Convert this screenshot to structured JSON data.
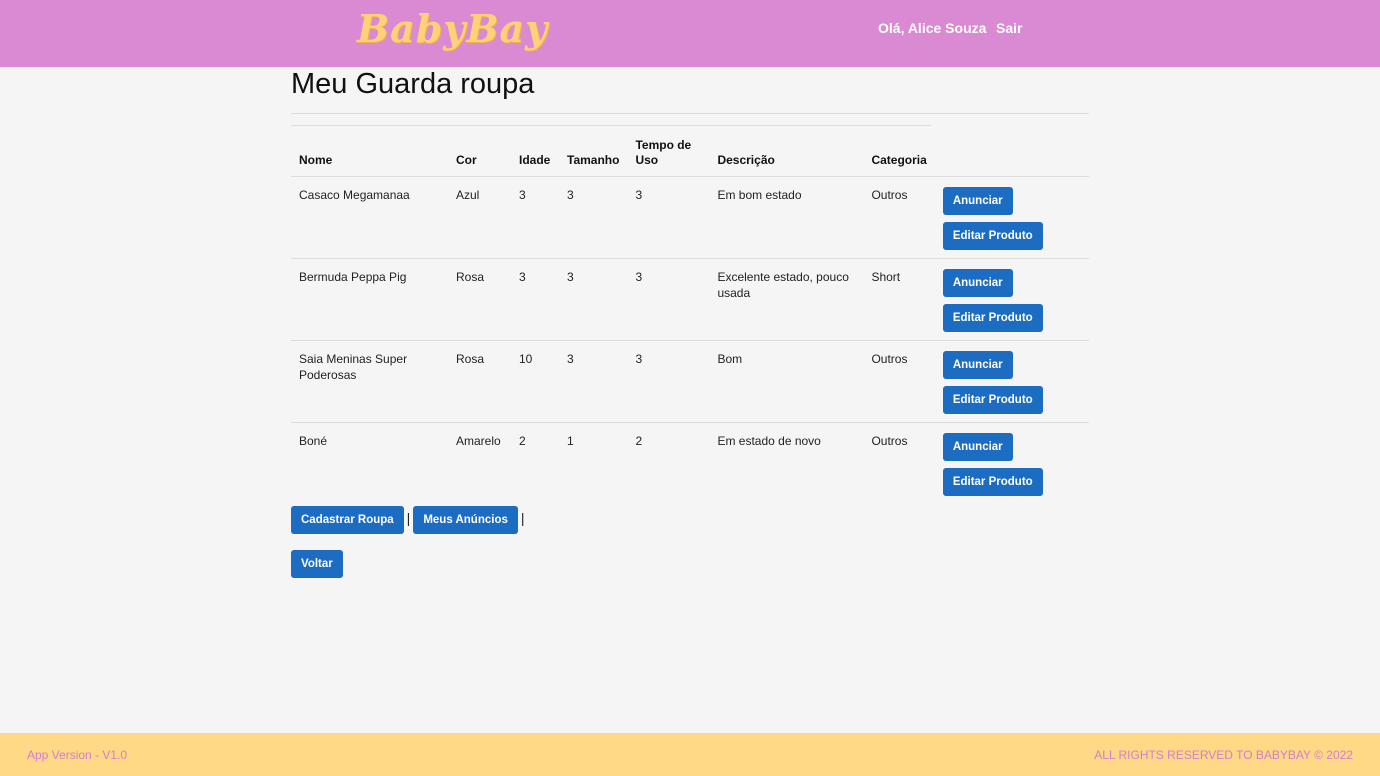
{
  "navbar": {
    "brand": "BabyBay",
    "user_greeting": "Olá, Alice Souza",
    "logout_label": "Sair"
  },
  "page": {
    "title": "Meu Guarda roupa"
  },
  "table": {
    "headers": [
      "Nome",
      "Cor",
      "Idade",
      "Tamanho",
      "Tempo de Uso",
      "Descrição",
      "Categoria"
    ],
    "rows": [
      {
        "nome": "Casaco Megamanaa",
        "cor": "Azul",
        "idade": "3",
        "tamanho": "3",
        "tempo_uso": "3",
        "descricao": "Em bom estado",
        "categoria": "Outros"
      },
      {
        "nome": "Bermuda Peppa Pig",
        "cor": "Rosa",
        "idade": "3",
        "tamanho": "3",
        "tempo_uso": "3",
        "descricao": "Excelente estado, pouco usada",
        "categoria": "Short"
      },
      {
        "nome": "Saia Meninas Super Poderosas",
        "cor": "Rosa",
        "idade": "10",
        "tamanho": "3",
        "tempo_uso": "3",
        "descricao": "Bom",
        "categoria": "Outros"
      },
      {
        "nome": "Boné",
        "cor": "Amarelo",
        "idade": "2",
        "tamanho": "1",
        "tempo_uso": "2",
        "descricao": "Em estado de novo",
        "categoria": "Outros"
      }
    ],
    "announce_label": "Anunciar",
    "edit_label": "Editar Produto"
  },
  "actions": {
    "register_label": "Cadastrar Roupa",
    "separator": "|",
    "my_ads_label": "Meus Anúncios",
    "back_label": "Voltar"
  },
  "footer": {
    "version": "App Version - V1.0",
    "rights": "ALL RIGHTS RESERVED TO BABYBAY © 2022"
  },
  "colors": {
    "navbar_bg": "#da89d3",
    "brand": "#ffd27a",
    "button_bg": "#1c6cc1",
    "footer_bg": "#ffd985",
    "footer_text": "#d77bd0"
  }
}
